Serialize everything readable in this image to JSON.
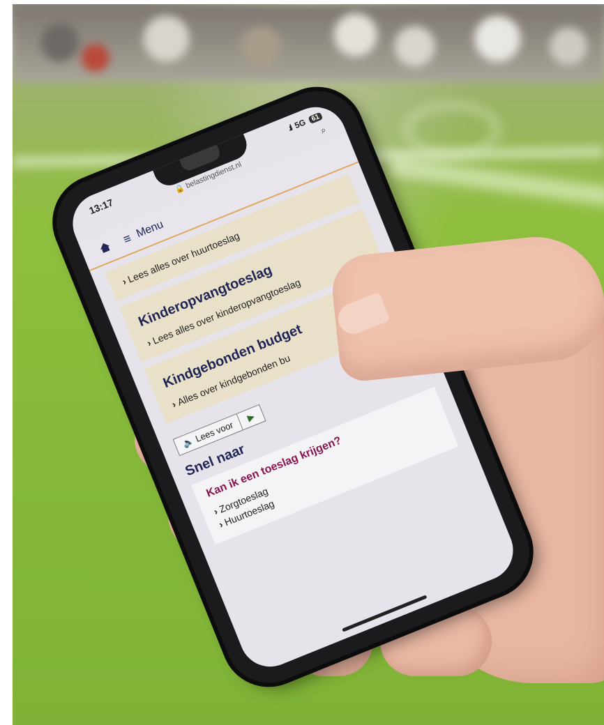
{
  "status": {
    "time": "13:17",
    "network": "5G",
    "battery": "61"
  },
  "browser": {
    "url": "belastingdienst.nl"
  },
  "nav": {
    "menu_label": "Menu"
  },
  "cards": [
    {
      "title": "",
      "link": "Lees alles over huurtoeslag"
    },
    {
      "title": "Kinderopvangtoeslag",
      "link": "Lees alles over kinderopvangtoeslag"
    },
    {
      "title": "Kindgebonden budget",
      "link": "Alles over kindgebonden bu"
    }
  ],
  "read_aloud": {
    "label": "Lees voor",
    "play": "▶"
  },
  "quick": {
    "heading": "Snel naar",
    "question": "Kan ik een toeslag krijgen?",
    "items": [
      "Zorgtoeslag",
      "Huurtoeslag"
    ]
  }
}
